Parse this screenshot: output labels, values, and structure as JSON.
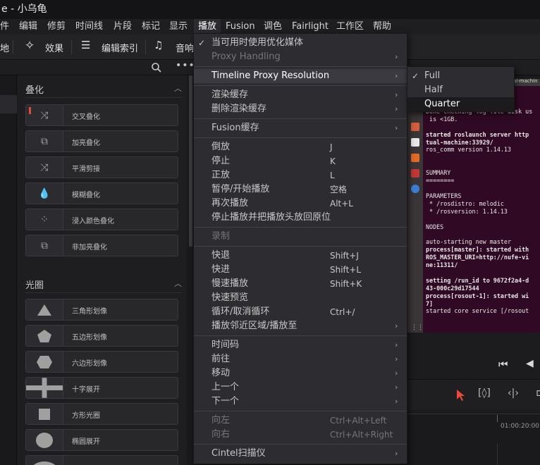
{
  "titlebar": {
    "title": "e - 小乌龟"
  },
  "menubar": {
    "items": [
      "件",
      "编辑",
      "修剪",
      "时间线",
      "片段",
      "标记",
      "显示",
      "播放",
      "Fusion",
      "调色",
      "Fairlight",
      "工作区",
      "帮助"
    ]
  },
  "toolbar": {
    "left_text": "地",
    "effects_label": "效果",
    "edit_index_label": "编辑索引",
    "audio_label": "音响"
  },
  "effects_panel": {
    "section1_title": "叠化",
    "section1_items": [
      "交叉叠化",
      "加亮叠化",
      "平滑剪接",
      "模糊叠化",
      "浸入颜色叠化",
      "非加亮叠化"
    ],
    "section2_title": "光圈",
    "section2_items": [
      "三角形划像",
      "五边形划像",
      "六边形划像",
      "十字展开",
      "方形光圈",
      "椭圆展开"
    ]
  },
  "playback_menu": {
    "items": [
      {
        "label": "当可用时使用优化媒体",
        "checked": true
      },
      {
        "label": "Proxy Handling",
        "submenu": true,
        "disabled": true
      },
      {
        "label": "Timeline Proxy Resolution",
        "submenu": true,
        "highlighted": true
      },
      {
        "label": "渲染缓存",
        "submenu": true
      },
      {
        "label": "删除渲染缓存",
        "submenu": true
      },
      {
        "label": "Fusion缓存",
        "submenu": true
      },
      {
        "label": "倒放",
        "shortcut": "J"
      },
      {
        "label": "停止",
        "shortcut": "K"
      },
      {
        "label": "正放",
        "shortcut": "L"
      },
      {
        "label": "暂停/开始播放",
        "shortcut": "空格"
      },
      {
        "label": "再次播放",
        "shortcut": "Alt+L"
      },
      {
        "label": "停止播放并把播放头放回原位"
      },
      {
        "label": "录制",
        "disabled": true
      },
      {
        "label": "快退",
        "shortcut": "Shift+J"
      },
      {
        "label": "快进",
        "shortcut": "Shift+L"
      },
      {
        "label": "慢速播放",
        "shortcut": "Shift+K"
      },
      {
        "label": "快速预览"
      },
      {
        "label": "循环/取消循环",
        "shortcut": "Ctrl+/"
      },
      {
        "label": "播放邻近区域/播放至",
        "submenu": true
      },
      {
        "label": "时间码",
        "submenu": true
      },
      {
        "label": "前往",
        "submenu": true
      },
      {
        "label": "移动",
        "submenu": true
      },
      {
        "label": "上一个",
        "submenu": true
      },
      {
        "label": "下一个",
        "submenu": true
      },
      {
        "label": "向左",
        "shortcut": "Ctrl+Alt+Left",
        "disabled": true
      },
      {
        "label": "向右",
        "shortcut": "Ctrl+Alt+Right",
        "disabled": true
      },
      {
        "label": "Cintel扫描仪",
        "submenu": true
      }
    ]
  },
  "proxy_submenu": {
    "items": [
      {
        "label": "Full",
        "checked": true
      },
      {
        "label": "Half"
      },
      {
        "label": "Quarter",
        "selected": true
      }
    ]
  },
  "terminal": {
    "tab_text": "al-machin",
    "lines": [
      {
        "t": "pt",
        "b": false
      },
      {
        "t": "Done checking log file disk us",
        "b": false
      },
      {
        "t": " is <1GB.",
        "b": false
      },
      {
        "t": "",
        "b": false
      },
      {
        "t": "started roslaunch server http",
        "b": true
      },
      {
        "t": "tual-machine:33929/",
        "b": true
      },
      {
        "t": "ros_comm version 1.14.13",
        "b": false
      },
      {
        "t": "",
        "b": false
      },
      {
        "t": "",
        "b": false
      },
      {
        "t": "SUMMARY",
        "b": false
      },
      {
        "t": "========",
        "b": false
      },
      {
        "t": "",
        "b": false
      },
      {
        "t": "PARAMETERS",
        "b": false
      },
      {
        "t": " * /rosdistro: melodic",
        "b": false
      },
      {
        "t": " * /rosversion: 1.14.13",
        "b": false
      },
      {
        "t": "",
        "b": false
      },
      {
        "t": "NODES",
        "b": false
      },
      {
        "t": "",
        "b": false
      },
      {
        "t": "auto-starting new master",
        "b": false
      },
      {
        "t": "process[master]: started with",
        "b": true
      },
      {
        "t": "ROS_MASTER_URI=http://nufe-vi",
        "b": true
      },
      {
        "t": "ne:11311/",
        "b": true
      },
      {
        "t": "",
        "b": false
      },
      {
        "t": "setting /run_id to 9672f2a4-d",
        "b": true
      },
      {
        "t": "43-000c29d17544",
        "b": true
      },
      {
        "t": "process[rosout-1]: started wi",
        "b": true
      },
      {
        "t": "7]",
        "b": true
      },
      {
        "t": "started core service [/rosout",
        "b": false
      }
    ]
  },
  "timeline": {
    "timecode": "01:00:20:00"
  }
}
